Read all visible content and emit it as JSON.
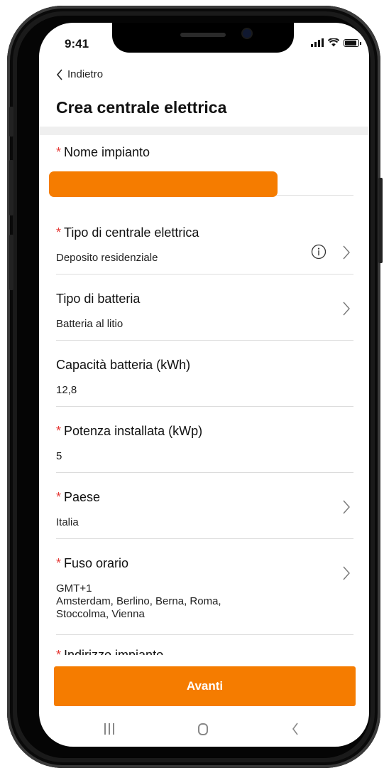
{
  "status_bar": {
    "time": "9:41"
  },
  "header": {
    "back_label": "Indietro",
    "title": "Crea centrale elettrica"
  },
  "form": {
    "plant_name": {
      "label": "Nome impianto",
      "required": true,
      "value": ""
    },
    "plant_type": {
      "label": "Tipo di centrale elettrica",
      "required": true,
      "value": "Deposito residenziale"
    },
    "battery_type": {
      "label": "Tipo di batteria",
      "required": false,
      "value": "Batteria al litio"
    },
    "battery_capacity": {
      "label": "Capacità batteria (kWh)",
      "required": false,
      "value": "12,8"
    },
    "installed_power": {
      "label": "Potenza installata (kWp)",
      "required": true,
      "value": "5"
    },
    "country": {
      "label": "Paese",
      "required": true,
      "value": "Italia"
    },
    "timezone": {
      "label": "Fuso orario",
      "required": true,
      "value_offset": "GMT+1",
      "value_cities": "Amsterdam, Berlino, Berna, Roma, Stoccolma, Vienna"
    },
    "plant_address": {
      "label": "Indirizzo impianto",
      "required": true
    }
  },
  "actions": {
    "next_label": "Avanti"
  },
  "colors": {
    "accent": "#f57c00",
    "required": "#e53935"
  },
  "icons": {
    "back": "chevron-left-icon",
    "chevron": "chevron-right-icon",
    "info": "info-icon"
  }
}
